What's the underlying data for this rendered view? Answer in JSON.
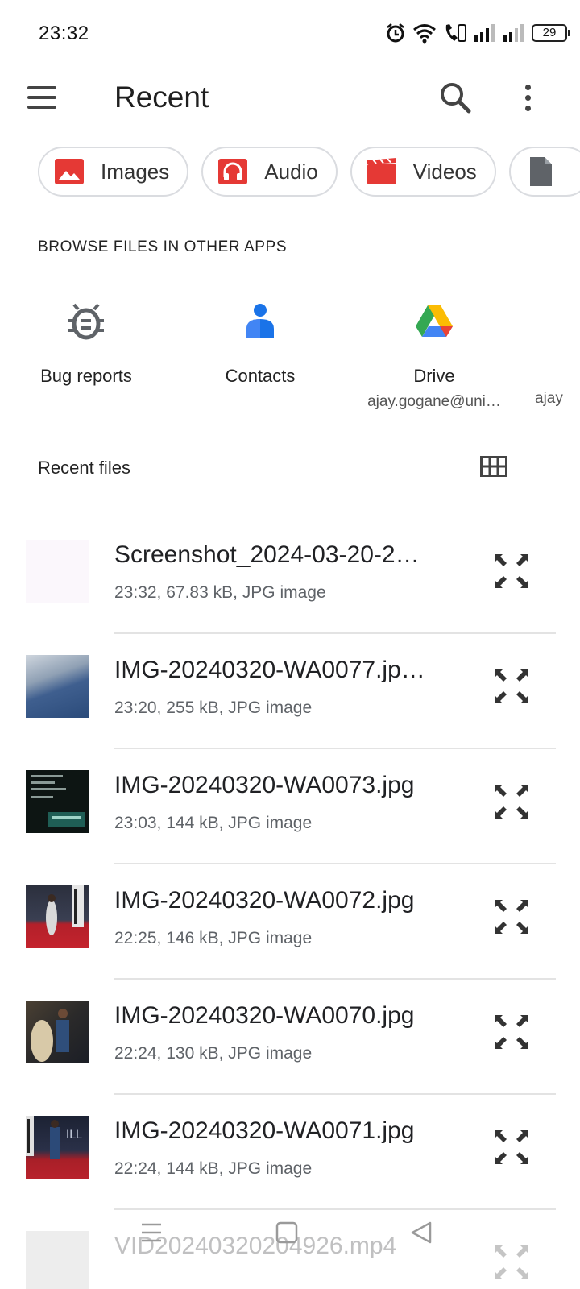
{
  "status": {
    "time": "23:32",
    "battery": "29"
  },
  "app_bar": {
    "title": "Recent",
    "menu_icon": "hamburger-menu-icon",
    "search_icon": "search-icon",
    "more_icon": "more-vert-icon"
  },
  "chips": [
    {
      "label": "Images",
      "icon": "image-icon",
      "color": "#e53935"
    },
    {
      "label": "Audio",
      "icon": "headphones-icon",
      "color": "#e53935"
    },
    {
      "label": "Videos",
      "icon": "movie-icon",
      "color": "#e53935"
    },
    {
      "label": "",
      "icon": "document-icon",
      "color": "#5f6368"
    }
  ],
  "browse": {
    "title": "BROWSE FILES IN OTHER APPS",
    "apps": [
      {
        "label": "Bug reports",
        "subtitle": "",
        "icon": "bug-icon"
      },
      {
        "label": "Contacts",
        "subtitle": "",
        "icon": "contacts-icon"
      },
      {
        "label": "Drive",
        "subtitle": "ajay.gogane@uni…",
        "icon": "google-drive-icon"
      }
    ],
    "peek_subtitle": "ajay"
  },
  "recent": {
    "title": "Recent files",
    "view_toggle_icon": "grid-view-icon",
    "files": [
      {
        "name": "Screenshot_2024-03-20-2…",
        "meta": "23:32, 67.83 kB, JPG image"
      },
      {
        "name": "IMG-20240320-WA0077.jp…",
        "meta": "23:20, 255 kB, JPG image"
      },
      {
        "name": "IMG-20240320-WA0073.jpg",
        "meta": "23:03, 144 kB, JPG image"
      },
      {
        "name": "IMG-20240320-WA0072.jpg",
        "meta": "22:25, 146 kB, JPG image"
      },
      {
        "name": "IMG-20240320-WA0070.jpg",
        "meta": "22:24, 130 kB, JPG image"
      },
      {
        "name": "IMG-20240320-WA0071.jpg",
        "meta": "22:24, 144 kB, JPG image"
      },
      {
        "name": "VID20240320204926.mp4",
        "meta": ""
      }
    ]
  },
  "nav": {
    "recents_icon": "recents-icon",
    "home_icon": "home-icon",
    "back_icon": "back-icon"
  }
}
